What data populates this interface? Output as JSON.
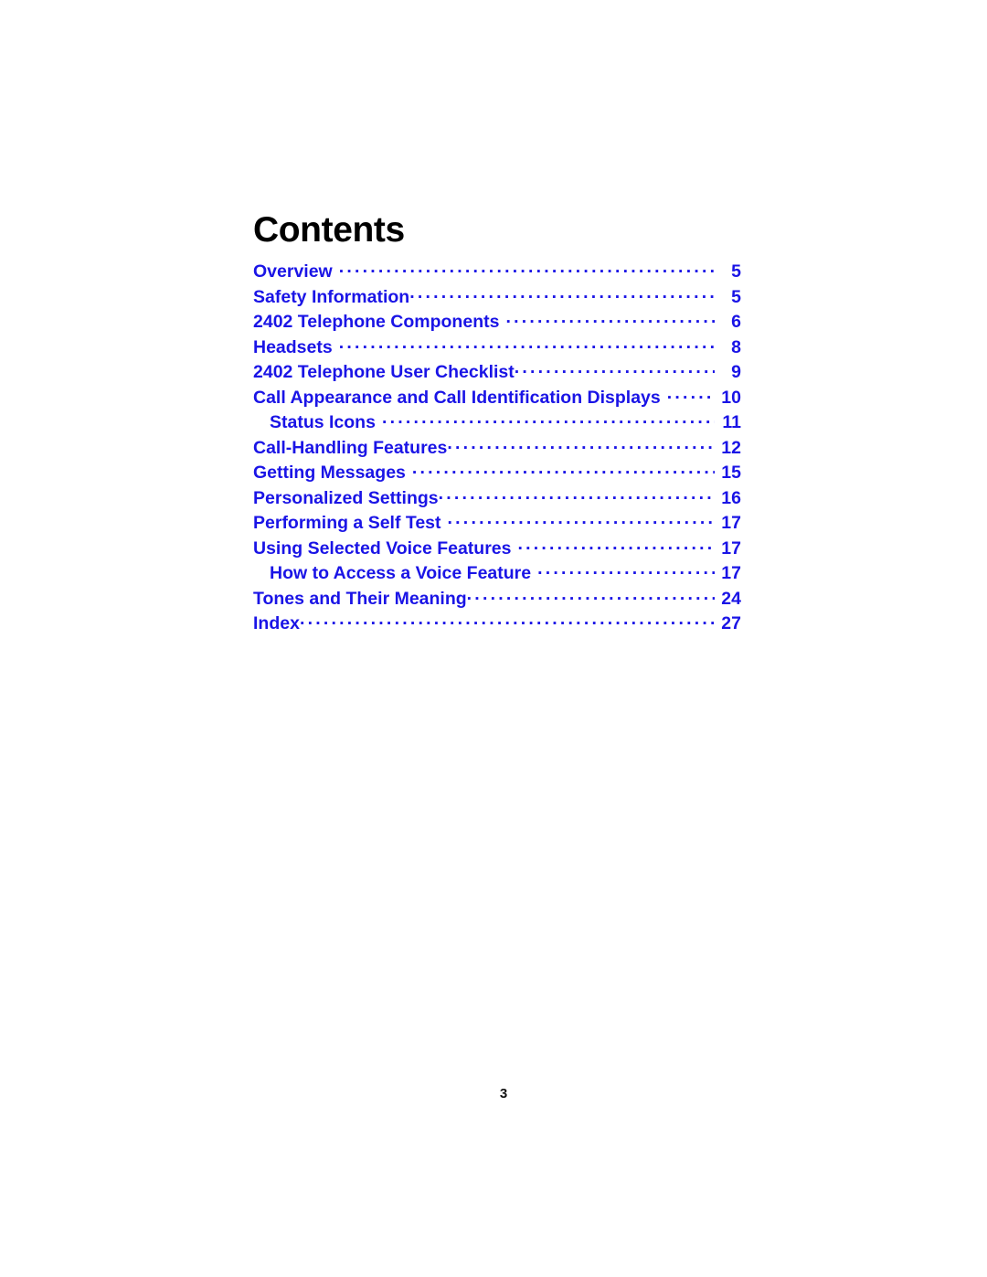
{
  "document": {
    "title": "Contents",
    "title_color": "#000000",
    "entry_color": "#1a14e6",
    "background_color": "#ffffff",
    "folio": "3"
  },
  "toc": {
    "heading": "Contents",
    "leader_char": ".",
    "entries": [
      {
        "label": "Overview",
        "page": "5",
        "level": 1,
        "leader_gap": true
      },
      {
        "label": "Safety Information",
        "page": "5",
        "level": 1,
        "leader_gap": false
      },
      {
        "label": "2402 Telephone Components",
        "page": "6",
        "level": 1,
        "leader_gap": true
      },
      {
        "label": "Headsets",
        "page": "8",
        "level": 1,
        "leader_gap": true
      },
      {
        "label": "2402 Telephone User Checklist",
        "page": "9",
        "level": 1,
        "leader_gap": false
      },
      {
        "label": "Call Appearance and Call Identification Displays",
        "page": "10",
        "level": 1,
        "leader_gap": true
      },
      {
        "label": "Status Icons",
        "page": "11",
        "level": 2,
        "leader_gap": true
      },
      {
        "label": "Call-Handling Features",
        "page": "12",
        "level": 1,
        "leader_gap": false
      },
      {
        "label": "Getting Messages",
        "page": "15",
        "level": 1,
        "leader_gap": true
      },
      {
        "label": "Personalized Settings",
        "page": "16",
        "level": 1,
        "leader_gap": false
      },
      {
        "label": "Performing a Self Test",
        "page": "17",
        "level": 1,
        "leader_gap": true
      },
      {
        "label": "Using Selected Voice Features",
        "page": "17",
        "level": 1,
        "leader_gap": true
      },
      {
        "label": "How to Access a Voice Feature",
        "page": "17",
        "level": 2,
        "leader_gap": true
      },
      {
        "label": "Tones and Their Meaning",
        "page": "24",
        "level": 1,
        "leader_gap": false
      },
      {
        "label": "Index",
        "page": "27",
        "level": 1,
        "leader_gap": false
      }
    ]
  }
}
